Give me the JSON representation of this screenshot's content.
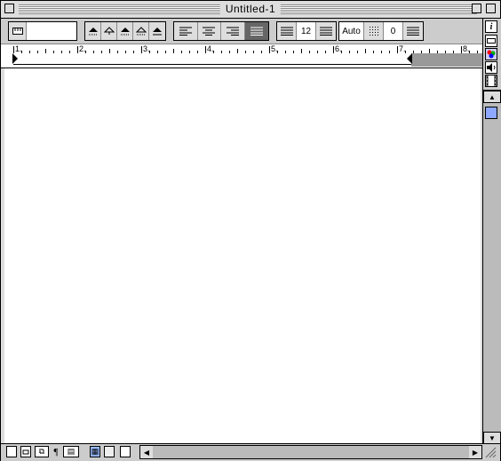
{
  "window": {
    "title": "Untitled-1"
  },
  "toolbar": {
    "font_size": "12",
    "line_spacing": "Auto",
    "space_before": "0"
  },
  "ruler": {
    "labels": [
      "1.",
      "2.",
      "3.",
      "4.",
      "5.",
      "6.",
      "7.",
      "8."
    ]
  },
  "palette": {
    "icons": [
      "info-icon",
      "ruler-icon",
      "color-icon",
      "sound-icon",
      "film-icon"
    ]
  },
  "status_bar": {
    "view_icons": [
      "page-view-icon",
      "column-view-icon",
      "header-icon",
      "pilcrow-icon",
      "footnote-icon",
      "document-icon",
      "gray-doc-icon",
      "outline-icon"
    ]
  }
}
